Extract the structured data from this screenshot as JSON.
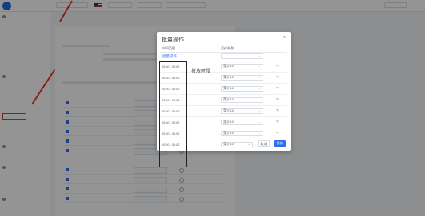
{
  "modal": {
    "title": "批量操作",
    "close_icon": "close-icon",
    "col_time": "时间范围",
    "col_bid": "竞价系数",
    "batch_link": "批量操作",
    "annotation": "投放时段",
    "rows": [
      {
        "time": "00:00 - 00:00",
        "bid": "竞价1.0"
      },
      {
        "time": "00:00 - 00:00",
        "bid": "竞价1.0"
      },
      {
        "time": "00:00 - 00:00",
        "bid": "竞价1.0"
      },
      {
        "time": "00:00 - 00:00",
        "bid": "竞价1.0"
      },
      {
        "time": "00:00 - 00:00",
        "bid": "竞价1.0"
      },
      {
        "time": "00:00 - 00:00",
        "bid": "竞价1.0"
      },
      {
        "time": "00:00 - 00:00",
        "bid": "竞价1.0"
      },
      {
        "time": "00:00 - 00:00",
        "bid": "竞价1.0"
      }
    ],
    "cancel_label": "取消",
    "ok_label": "保存"
  },
  "colors": {
    "accent": "#2f6fed",
    "annotation_red": "#e53935"
  }
}
